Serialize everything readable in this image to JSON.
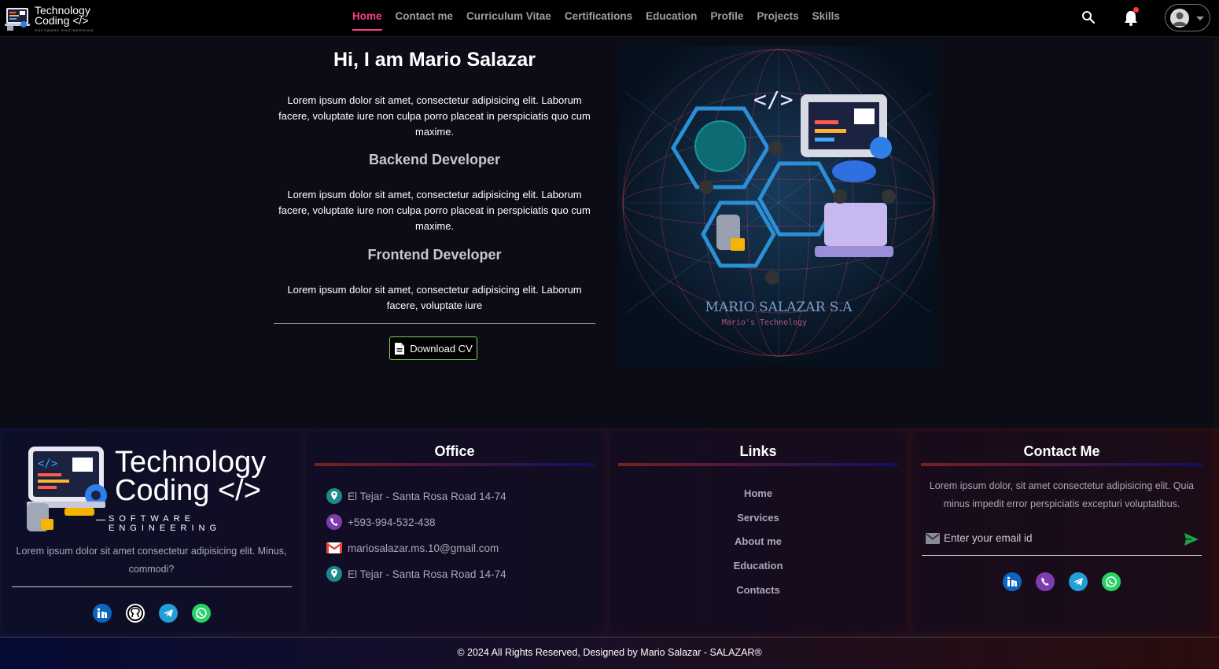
{
  "logo": {
    "line1": "Technology",
    "line2": "Coding </>",
    "line3": "SOFTWARE ENGINEERING"
  },
  "nav": {
    "items": [
      "Home",
      "Contact me",
      "Curriculum Vitae",
      "Certifications",
      "Education",
      "Profile",
      "Projects",
      "Skills"
    ],
    "active": "Home"
  },
  "hero": {
    "title": "Hi, I am Mario Salazar",
    "intro": "Lorem ipsum dolor sit amet, consectetur adipisicing elit. Laborum facere, voluptate iure non culpa porro placeat in perspiciatis quo cum maxime.",
    "backend_title": "Backend Developer",
    "backend_text": "Lorem ipsum dolor sit amet, consectetur adipisicing elit. Laborum facere, voluptate iure non culpa porro placeat in perspiciatis quo cum maxime.",
    "frontend_title": "Frontend Developer",
    "frontend_text": "Lorem ipsum dolor sit amet, consectetur adipisicing elit. Laborum facere, voluptate iure",
    "download_label": "Download CV",
    "image_caption": "MARIO SALAZAR S.A",
    "image_subcaption": "Mario's Technology"
  },
  "footer": {
    "brand": {
      "line1": "Technology",
      "line2": "Coding </>",
      "line3": "SOFTWARE ENGINEERING",
      "desc": "Lorem ipsum dolor sit amet consectetur adipisicing elit. Minus, commodi?"
    },
    "office": {
      "title": "Office",
      "rows": [
        {
          "icon": "location-pin-icon",
          "text": "El Tejar - Santa Rosa Road 14-74"
        },
        {
          "icon": "viber-phone-icon",
          "text": "+593-994-532-438"
        },
        {
          "icon": "gmail-icon",
          "text": "mariosalazar.ms.10@gmail.com"
        },
        {
          "icon": "location-pin-icon",
          "text": "El Tejar - Santa Rosa Road 14-74"
        }
      ]
    },
    "links": {
      "title": "Links",
      "items": [
        "Home",
        "Services",
        "About me",
        "Education",
        "Contacts"
      ]
    },
    "contact": {
      "title": "Contact Me",
      "desc": "Lorem ipsum dolor, sit amet consectetur adipisicing elit. Quia minus impedit error perspiciatis excepturi voluptatibus.",
      "email_placeholder": "Enter your email id"
    },
    "copyright": "© 2024 All Rights Reserved, Designed by Mario Salazar - SALAZAR®"
  },
  "colors": {
    "accent_active": "#ff3d8b",
    "button_border": "#7ed957",
    "linkedin": "#0a66c2",
    "github": "#ffffff",
    "telegram": "#229ed9",
    "whatsapp": "#25d366",
    "viber": "#7d3daf",
    "send_arrow": "#1aa34a"
  }
}
